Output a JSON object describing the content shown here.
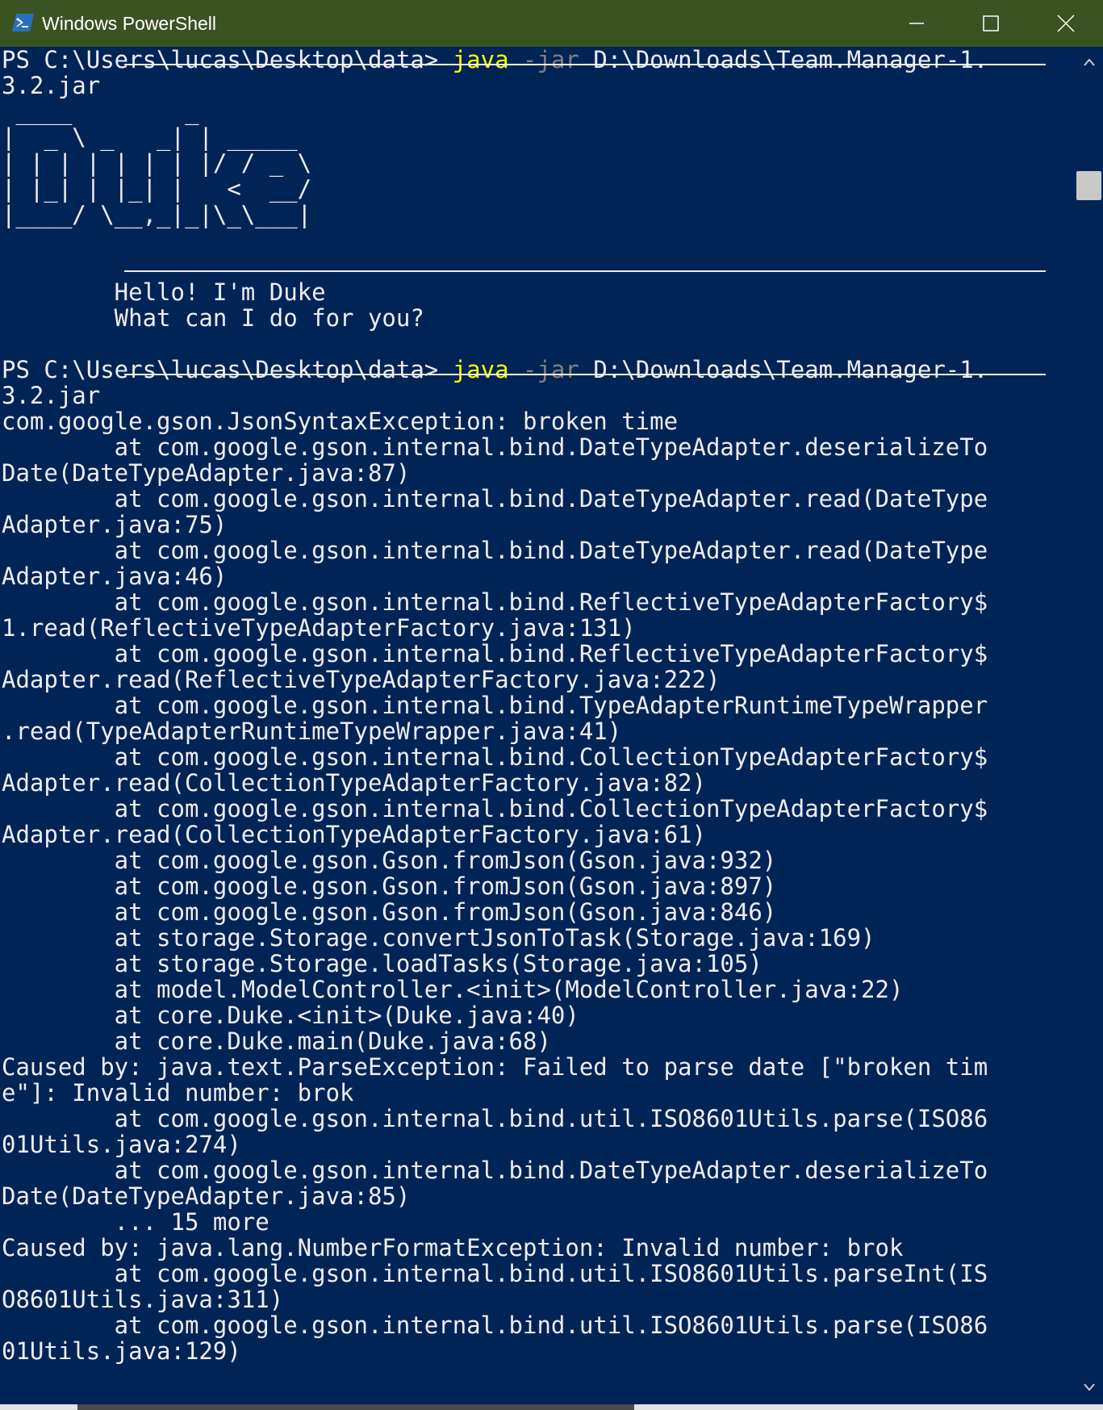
{
  "window": {
    "title": "Windows PowerShell",
    "colors": {
      "titlebar": "#3b5222",
      "console_bg": "#012456",
      "text": "#eeedf0",
      "command": "#ffff00",
      "parameter": "#808080"
    }
  },
  "console": {
    "lines": [
      {
        "rule": true,
        "parts": [
          {
            "t": "PS C:\\Users\\lucas\\Desktop\\data> "
          },
          {
            "t": "java",
            "c": "cmd"
          },
          {
            "t": " -jar",
            "c": "param"
          },
          {
            "t": " D:\\Downloads\\Team.Manager-1."
          }
        ]
      },
      {
        "parts": [
          {
            "t": "3.2.jar"
          }
        ]
      },
      {
        "parts": [
          {
            "t": " ____        _        "
          }
        ]
      },
      {
        "parts": [
          {
            "t": "|  _ \\ _   _| | _____ "
          }
        ]
      },
      {
        "parts": [
          {
            "t": "| | | | | | | |/ / _ \\"
          }
        ]
      },
      {
        "parts": [
          {
            "t": "| |_| | |_| |   <  __/"
          }
        ]
      },
      {
        "parts": [
          {
            "t": "|____/ \\__,_|_|\\_\\___|"
          }
        ]
      },
      {
        "parts": [
          {
            "t": ""
          }
        ]
      },
      {
        "rule": true,
        "parts": [
          {
            "t": ""
          }
        ]
      },
      {
        "parts": [
          {
            "t": "        Hello! I'm Duke"
          }
        ]
      },
      {
        "parts": [
          {
            "t": "        What can I do for you?"
          }
        ]
      },
      {
        "parts": [
          {
            "t": ""
          }
        ]
      },
      {
        "rule": true,
        "parts": [
          {
            "t": "PS C:\\Users\\lucas\\Desktop\\data> "
          },
          {
            "t": "java",
            "c": "cmd"
          },
          {
            "t": " -jar",
            "c": "param"
          },
          {
            "t": " D:\\Downloads\\Team.Manager-1."
          }
        ]
      },
      {
        "parts": [
          {
            "t": "3.2.jar"
          }
        ]
      },
      {
        "parts": [
          {
            "t": "com.google.gson.JsonSyntaxException: broken time"
          }
        ]
      },
      {
        "parts": [
          {
            "t": "        at com.google.gson.internal.bind.DateTypeAdapter.deserializeTo"
          }
        ]
      },
      {
        "parts": [
          {
            "t": "Date(DateTypeAdapter.java:87)"
          }
        ]
      },
      {
        "parts": [
          {
            "t": "        at com.google.gson.internal.bind.DateTypeAdapter.read(DateType"
          }
        ]
      },
      {
        "parts": [
          {
            "t": "Adapter.java:75)"
          }
        ]
      },
      {
        "parts": [
          {
            "t": "        at com.google.gson.internal.bind.DateTypeAdapter.read(DateType"
          }
        ]
      },
      {
        "parts": [
          {
            "t": "Adapter.java:46)"
          }
        ]
      },
      {
        "parts": [
          {
            "t": "        at com.google.gson.internal.bind.ReflectiveTypeAdapterFactory$"
          }
        ]
      },
      {
        "parts": [
          {
            "t": "1.read(ReflectiveTypeAdapterFactory.java:131)"
          }
        ]
      },
      {
        "parts": [
          {
            "t": "        at com.google.gson.internal.bind.ReflectiveTypeAdapterFactory$"
          }
        ]
      },
      {
        "parts": [
          {
            "t": "Adapter.read(ReflectiveTypeAdapterFactory.java:222)"
          }
        ]
      },
      {
        "parts": [
          {
            "t": "        at com.google.gson.internal.bind.TypeAdapterRuntimeTypeWrapper"
          }
        ]
      },
      {
        "parts": [
          {
            "t": ".read(TypeAdapterRuntimeTypeWrapper.java:41)"
          }
        ]
      },
      {
        "parts": [
          {
            "t": "        at com.google.gson.internal.bind.CollectionTypeAdapterFactory$"
          }
        ]
      },
      {
        "parts": [
          {
            "t": "Adapter.read(CollectionTypeAdapterFactory.java:82)"
          }
        ]
      },
      {
        "parts": [
          {
            "t": "        at com.google.gson.internal.bind.CollectionTypeAdapterFactory$"
          }
        ]
      },
      {
        "parts": [
          {
            "t": "Adapter.read(CollectionTypeAdapterFactory.java:61)"
          }
        ]
      },
      {
        "parts": [
          {
            "t": "        at com.google.gson.Gson.fromJson(Gson.java:932)"
          }
        ]
      },
      {
        "parts": [
          {
            "t": "        at com.google.gson.Gson.fromJson(Gson.java:897)"
          }
        ]
      },
      {
        "parts": [
          {
            "t": "        at com.google.gson.Gson.fromJson(Gson.java:846)"
          }
        ]
      },
      {
        "parts": [
          {
            "t": "        at storage.Storage.convertJsonToTask(Storage.java:169)"
          }
        ]
      },
      {
        "parts": [
          {
            "t": "        at storage.Storage.loadTasks(Storage.java:105)"
          }
        ]
      },
      {
        "parts": [
          {
            "t": "        at model.ModelController.<init>(ModelController.java:22)"
          }
        ]
      },
      {
        "parts": [
          {
            "t": "        at core.Duke.<init>(Duke.java:40)"
          }
        ]
      },
      {
        "parts": [
          {
            "t": "        at core.Duke.main(Duke.java:68)"
          }
        ]
      },
      {
        "parts": [
          {
            "t": "Caused by: java.text.ParseException: Failed to parse date [\"broken tim"
          }
        ]
      },
      {
        "parts": [
          {
            "t": "e\"]: Invalid number: brok"
          }
        ]
      },
      {
        "parts": [
          {
            "t": "        at com.google.gson.internal.bind.util.ISO8601Utils.parse(ISO86"
          }
        ]
      },
      {
        "parts": [
          {
            "t": "01Utils.java:274)"
          }
        ]
      },
      {
        "parts": [
          {
            "t": "        at com.google.gson.internal.bind.DateTypeAdapter.deserializeTo"
          }
        ]
      },
      {
        "parts": [
          {
            "t": "Date(DateTypeAdapter.java:85)"
          }
        ]
      },
      {
        "parts": [
          {
            "t": "        ... 15 more"
          }
        ]
      },
      {
        "parts": [
          {
            "t": "Caused by: java.lang.NumberFormatException: Invalid number: brok"
          }
        ]
      },
      {
        "parts": [
          {
            "t": "        at com.google.gson.internal.bind.util.ISO8601Utils.parseInt(IS"
          }
        ]
      },
      {
        "parts": [
          {
            "t": "O8601Utils.java:311)"
          }
        ]
      },
      {
        "parts": [
          {
            "t": "        at com.google.gson.internal.bind.util.ISO8601Utils.parse(ISO86"
          }
        ]
      },
      {
        "parts": [
          {
            "t": "01Utils.java:129)"
          }
        ]
      }
    ]
  },
  "icons": {
    "app": "powershell-icon",
    "minimize": "minimize-icon",
    "maximize": "maximize-icon",
    "close": "close-icon"
  }
}
